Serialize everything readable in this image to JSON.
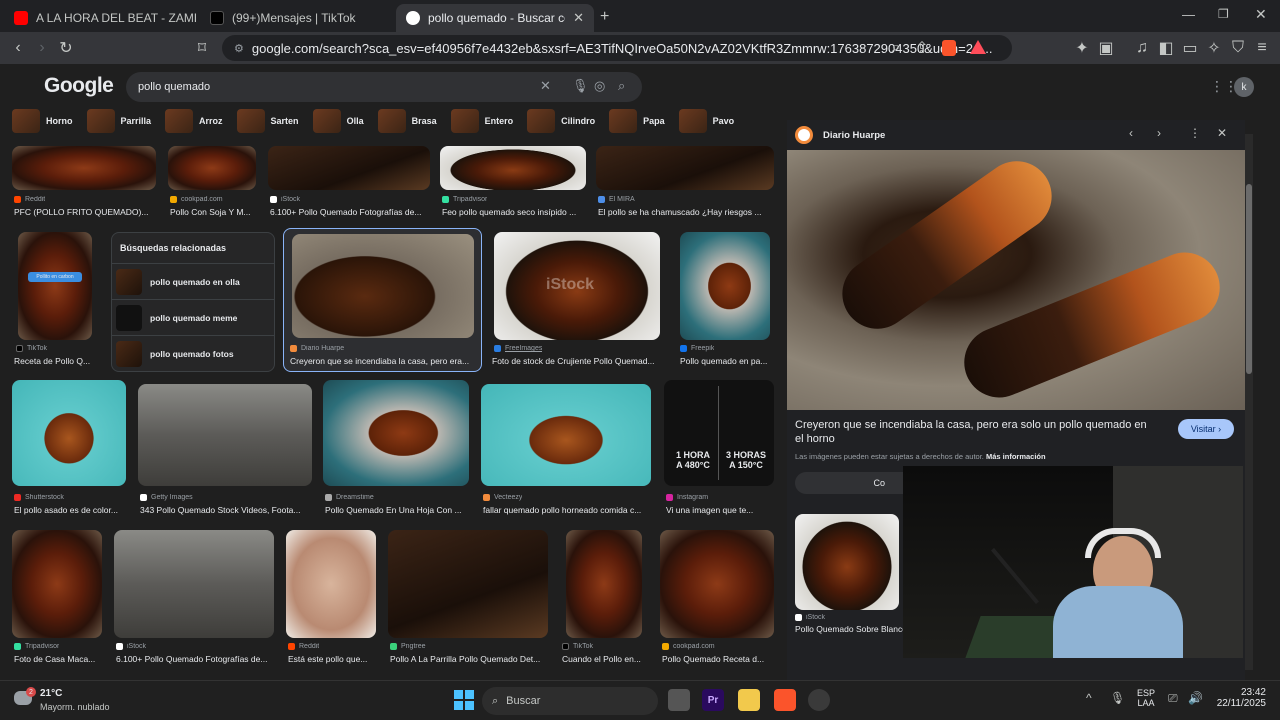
{
  "browser": {
    "tabs": [
      {
        "title": "A LA HORA DEL BEAT - ZAMBO CAVE",
        "favicon": "youtube-icon",
        "color": "#ff0000"
      },
      {
        "title": "(99+)Mensajes | TikTok",
        "favicon": "tiktok-icon",
        "color": "#000000"
      },
      {
        "title": "pollo quemado - Buscar con Goo",
        "favicon": "google-icon",
        "color": "#ffffff"
      }
    ],
    "new_tab": "+",
    "url": "google.com/search?sca_esv=ef40956f7e4432eb&sxsrf=AE3TifNQIrveOa50N2vAZ02VKtfR3Zmmrw:1763872904350&udm=2&..."
  },
  "google": {
    "logo": "Google",
    "query": "pollo quemado",
    "chips": [
      "Horno",
      "Parrilla",
      "Arroz",
      "Sarten",
      "Olla",
      "Brasa",
      "Entero",
      "Cilindro",
      "Papa",
      "Pavo"
    ],
    "avatar": "k"
  },
  "results": {
    "row1": [
      {
        "source": "Reddit",
        "title": "PFC (POLLO FRITO QUEMADO)..."
      },
      {
        "source": "cookpad.com",
        "title": "Pollo Con Soja Y M..."
      },
      {
        "source": "iStock",
        "title": "6.100+ Pollo Quemado Fotografías de..."
      },
      {
        "source": "Tripadvisor",
        "title": "Feo pollo quemado seco insípido ..."
      },
      {
        "source": "El MIRA",
        "title": "El pollo se ha chamuscado ¿Hay riesgos ..."
      }
    ],
    "row2": [
      {
        "source": "TikTok",
        "title": "Receta de Pollo Q...",
        "overlay": "Pollito en carbon"
      },
      {
        "source": "Diario Huarpe",
        "title": "Creyeron que se incendiaba la casa, pero era..."
      },
      {
        "source": "FreeImages",
        "title": "Foto de stock de Crujiente Pollo Quemad...",
        "watermark": "iStock"
      },
      {
        "source": "Freepik",
        "title": "Pollo quemado en pa..."
      }
    ],
    "related": {
      "title": "Búsquedas relacionadas",
      "items": [
        "pollo quemado en olla",
        "pollo quemado meme",
        "pollo quemado fotos"
      ]
    },
    "row3": [
      {
        "source": "Shutterstock",
        "title": "El pollo asado es de color..."
      },
      {
        "source": "Getty Images",
        "title": "343 Pollo Quemado Stock Videos, Foota..."
      },
      {
        "source": "Dreamstime",
        "title": "Pollo Quemado En Una Hoja Con ..."
      },
      {
        "source": "Vecteezy",
        "title": "fallar quemado pollo horneado comida c..."
      },
      {
        "source": "Instagram",
        "title": "Vi una imagen que te...",
        "left_label": "1 HORA\nA 480°C",
        "right_label": "3 HORAS\nA 150°C"
      }
    ],
    "row4": [
      {
        "source": "Tripadvisor",
        "title": "Foto de Casa Maca..."
      },
      {
        "source": "iStock",
        "title": "6.100+ Pollo Quemado Fotografías de..."
      },
      {
        "source": "Reddit",
        "title": "Está este pollo que..."
      },
      {
        "source": "Pngtree",
        "title": "Pollo A La Parrilla Pollo Quemado Det..."
      },
      {
        "source": "TikTok",
        "title": "Cuando el Pollo en..."
      },
      {
        "source": "cookpad.com",
        "title": "Pollo Quemado Receta d..."
      }
    ]
  },
  "panel": {
    "source": "Diario Huarpe",
    "title": "Creyeron que se incendiaba la casa, pero era solo un pollo quemado en el horno",
    "visit": "Visitar",
    "copyright": "Las imágenes pueden estar sujetas a derechos de autor.",
    "more_info": "Más información",
    "share": "Co",
    "related_source": "iStock",
    "related_title": "Pollo Quemado Sobre Blanco"
  },
  "taskbar": {
    "temp": "21°C",
    "weather": "Mayorm. nublado",
    "search": "Buscar",
    "lang1": "ESP",
    "lang2": "LAA",
    "time": "23:42",
    "date": "22/11/2025",
    "badge": "2"
  }
}
